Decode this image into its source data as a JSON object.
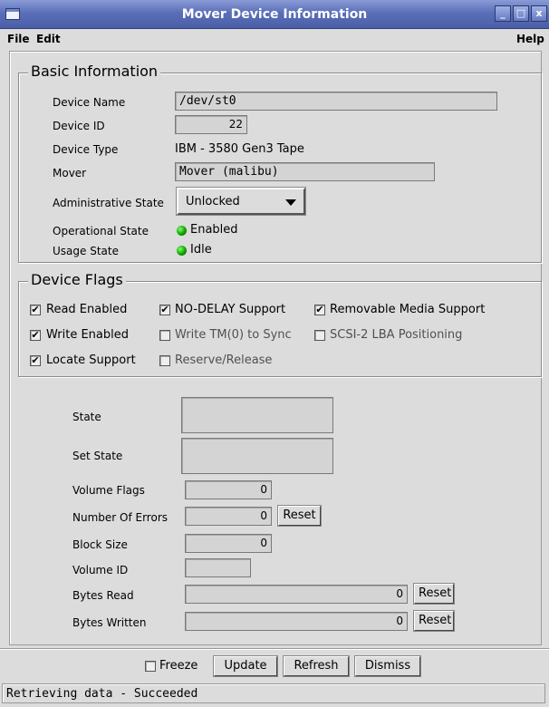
{
  "window": {
    "title": "Mover Device Information"
  },
  "menu": {
    "file": "File",
    "edit": "Edit",
    "help": "Help"
  },
  "basic": {
    "legend": "Basic Information",
    "device_name_label": "Device Name",
    "device_name_value": "/dev/st0",
    "device_id_label": "Device ID",
    "device_id_value": "22",
    "device_type_label": "Device Type",
    "device_type_value": "IBM - 3580 Gen3 Tape",
    "mover_label": "Mover",
    "mover_value": "Mover (malibu)",
    "admin_state_label": "Administrative State",
    "admin_state_value": "Unlocked",
    "op_state_label": "Operational State",
    "op_state_value": "Enabled",
    "usage_state_label": "Usage State",
    "usage_state_value": "Idle"
  },
  "flags": {
    "legend": "Device Flags",
    "items": [
      {
        "label": "Read Enabled",
        "checked": true
      },
      {
        "label": "NO-DELAY Support",
        "checked": true
      },
      {
        "label": "Removable Media Support",
        "checked": true
      },
      {
        "label": "Write Enabled",
        "checked": true
      },
      {
        "label": "Write TM(0) to Sync",
        "checked": false
      },
      {
        "label": "SCSI-2 LBA Positioning",
        "checked": false
      },
      {
        "label": "Locate Support",
        "checked": true
      },
      {
        "label": "Reserve/Release",
        "checked": false
      }
    ]
  },
  "stats": {
    "state_label": "State",
    "set_state_label": "Set State",
    "volume_flags_label": "Volume Flags",
    "volume_flags_value": "0",
    "num_errors_label": "Number Of Errors",
    "num_errors_value": "0",
    "block_size_label": "Block Size",
    "block_size_value": "0",
    "volume_id_label": "Volume ID",
    "volume_id_value": "",
    "bytes_read_label": "Bytes Read",
    "bytes_read_value": "0",
    "bytes_written_label": "Bytes Written",
    "bytes_written_value": "0",
    "reset_label": "Reset"
  },
  "footer": {
    "freeze_label": "Freeze",
    "freeze_checked": false,
    "update_label": "Update",
    "refresh_label": "Refresh",
    "dismiss_label": "Dismiss"
  },
  "status": "Retrieving data - Succeeded"
}
